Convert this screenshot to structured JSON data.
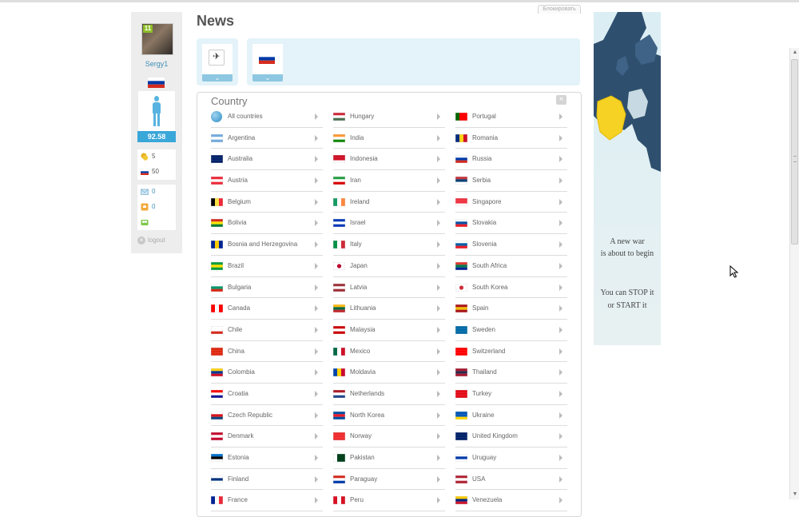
{
  "top_tab": "Блокировать",
  "news_title": "News",
  "user": {
    "level": "11",
    "name": "Sergy1",
    "stat": "92.58",
    "gold": "5",
    "currency": "50",
    "messages": "0",
    "alerts": "0",
    "logout": "logout"
  },
  "filter": {
    "chevron": "⌄"
  },
  "country_list": {
    "title": "Country",
    "close": "×",
    "col1": [
      "All countries",
      "Argentina",
      "Australia",
      "Austria",
      "Belgium",
      "Bolivia",
      "Bosnia and Herzegovina",
      "Brazil",
      "Bulgaria",
      "Canada",
      "Chile",
      "China",
      "Colombia",
      "Croatia",
      "Czech Republic",
      "Denmark",
      "Estonia",
      "Finland",
      "France"
    ],
    "col2": [
      "Hungary",
      "India",
      "Indonesia",
      "Iran",
      "Ireland",
      "Israel",
      "Italy",
      "Japan",
      "Latvia",
      "Lithuania",
      "Malaysia",
      "Mexico",
      "Moldavia",
      "Netherlands",
      "North Korea",
      "Norway",
      "Pakistan",
      "Paraguay",
      "Peru"
    ],
    "col3": [
      "Portugal",
      "Romania",
      "Russia",
      "Serbia",
      "Singapore",
      "Slovakia",
      "Slovenia",
      "South Africa",
      "South Korea",
      "Spain",
      "Sweden",
      "Switzerland",
      "Thailand",
      "Turkey",
      "Ukraine",
      "United Kingdom",
      "Uruguay",
      "USA",
      "Venezuela"
    ]
  },
  "ad": {
    "line1": "A new war",
    "line2": "is about to begin",
    "line3": "You can STOP it",
    "line4": "or START it"
  },
  "flags": {
    "Argentina": [
      "#74acdf",
      "#ffffff",
      "#74acdf"
    ],
    "Australia": [
      "#012169",
      "#012169",
      "#012169"
    ],
    "Austria": [
      "#ed2939",
      "#ffffff",
      "#ed2939"
    ],
    "Belgium": [
      "#000000",
      "#fae042",
      "#ed2939",
      "v"
    ],
    "Bolivia": [
      "#d52b1e",
      "#f9e300",
      "#007934"
    ],
    "Bosnia and Herzegovina": [
      "#002395",
      "#fecb00",
      "#002395",
      "v"
    ],
    "Brazil": [
      "#009c3b",
      "#ffdf00",
      "#009c3b"
    ],
    "Bulgaria": [
      "#ffffff",
      "#00966e",
      "#d62612"
    ],
    "Canada": [
      "#ff0000",
      "#ffffff",
      "#ff0000",
      "v"
    ],
    "Chile": [
      "#ffffff",
      "#ffffff",
      "#d52b1e"
    ],
    "China": [
      "#de2910",
      "#de2910",
      "#de2910"
    ],
    "Colombia": [
      "#fcd116",
      "#003893",
      "#ce1126"
    ],
    "Croatia": [
      "#ff0000",
      "#ffffff",
      "#171796"
    ],
    "Czech Republic": [
      "#ffffff",
      "#d7141a",
      "#11457e"
    ],
    "Denmark": [
      "#c60c30",
      "#ffffff",
      "#c60c30"
    ],
    "Estonia": [
      "#0072ce",
      "#000000",
      "#ffffff"
    ],
    "Finland": [
      "#ffffff",
      "#003580",
      "#ffffff"
    ],
    "France": [
      "#002395",
      "#ffffff",
      "#ed2939",
      "v"
    ],
    "Hungary": [
      "#ce2939",
      "#ffffff",
      "#477050"
    ],
    "India": [
      "#ff9933",
      "#ffffff",
      "#138808"
    ],
    "Indonesia": [
      "#ce1126",
      "#ce1126",
      "#ffffff"
    ],
    "Iran": [
      "#239f40",
      "#ffffff",
      "#da0000"
    ],
    "Ireland": [
      "#169b62",
      "#ffffff",
      "#ff883e",
      "v"
    ],
    "Israel": [
      "#0038b8",
      "#ffffff",
      "#0038b8"
    ],
    "Italy": [
      "#009246",
      "#ffffff",
      "#ce2b37",
      "v"
    ],
    "Japan": [
      "#ffffff",
      "#ffffff",
      "#ffffff"
    ],
    "Latvia": [
      "#9e3039",
      "#ffffff",
      "#9e3039"
    ],
    "Lithuania": [
      "#fdb913",
      "#006a44",
      "#c1272d"
    ],
    "Malaysia": [
      "#cc0001",
      "#ffffff",
      "#cc0001"
    ],
    "Mexico": [
      "#006847",
      "#ffffff",
      "#ce1126",
      "v"
    ],
    "Moldavia": [
      "#0046ae",
      "#ffd200",
      "#cc092f",
      "v"
    ],
    "Netherlands": [
      "#ae1c28",
      "#ffffff",
      "#21468b"
    ],
    "North Korea": [
      "#024fa2",
      "#ed1c27",
      "#024fa2"
    ],
    "Norway": [
      "#ef2b2d",
      "#ef2b2d",
      "#ef2b2d"
    ],
    "Pakistan": [
      "#ffffff",
      "#01411c",
      "#01411c",
      "v"
    ],
    "Paraguay": [
      "#d52b1e",
      "#ffffff",
      "#0038a8"
    ],
    "Peru": [
      "#d91023",
      "#ffffff",
      "#d91023",
      "v"
    ],
    "Portugal": [
      "#006600",
      "#ff0000",
      "#ff0000",
      "v"
    ],
    "Romania": [
      "#002b7f",
      "#fcd116",
      "#ce1126",
      "v"
    ],
    "Russia": [
      "#ffffff",
      "#0039a6",
      "#d52b1e"
    ],
    "Serbia": [
      "#c6363c",
      "#0c4076",
      "#ffffff"
    ],
    "Singapore": [
      "#ef3340",
      "#ef3340",
      "#ffffff"
    ],
    "Slovakia": [
      "#ffffff",
      "#0b4ea2",
      "#ee1c25"
    ],
    "Slovenia": [
      "#ffffff",
      "#005da4",
      "#ed1c24"
    ],
    "South Africa": [
      "#de3831",
      "#007a4d",
      "#002395"
    ],
    "South Korea": [
      "#ffffff",
      "#ffffff",
      "#ffffff"
    ],
    "Spain": [
      "#aa151b",
      "#f1bf00",
      "#aa151b"
    ],
    "Sweden": [
      "#006aa7",
      "#006aa7",
      "#006aa7"
    ],
    "Switzerland": [
      "#ff0000",
      "#ff0000",
      "#ff0000"
    ],
    "Thailand": [
      "#a51931",
      "#2d2a4a",
      "#a51931"
    ],
    "Turkey": [
      "#e30a17",
      "#e30a17",
      "#e30a17"
    ],
    "Ukraine": [
      "#0057b7",
      "#0057b7",
      "#ffd700"
    ],
    "United Kingdom": [
      "#012169",
      "#012169",
      "#012169"
    ],
    "Uruguay": [
      "#ffffff",
      "#0038a8",
      "#ffffff"
    ],
    "USA": [
      "#b22234",
      "#ffffff",
      "#b22234"
    ],
    "Venezuela": [
      "#ffcc00",
      "#00247d",
      "#cf142b"
    ]
  }
}
